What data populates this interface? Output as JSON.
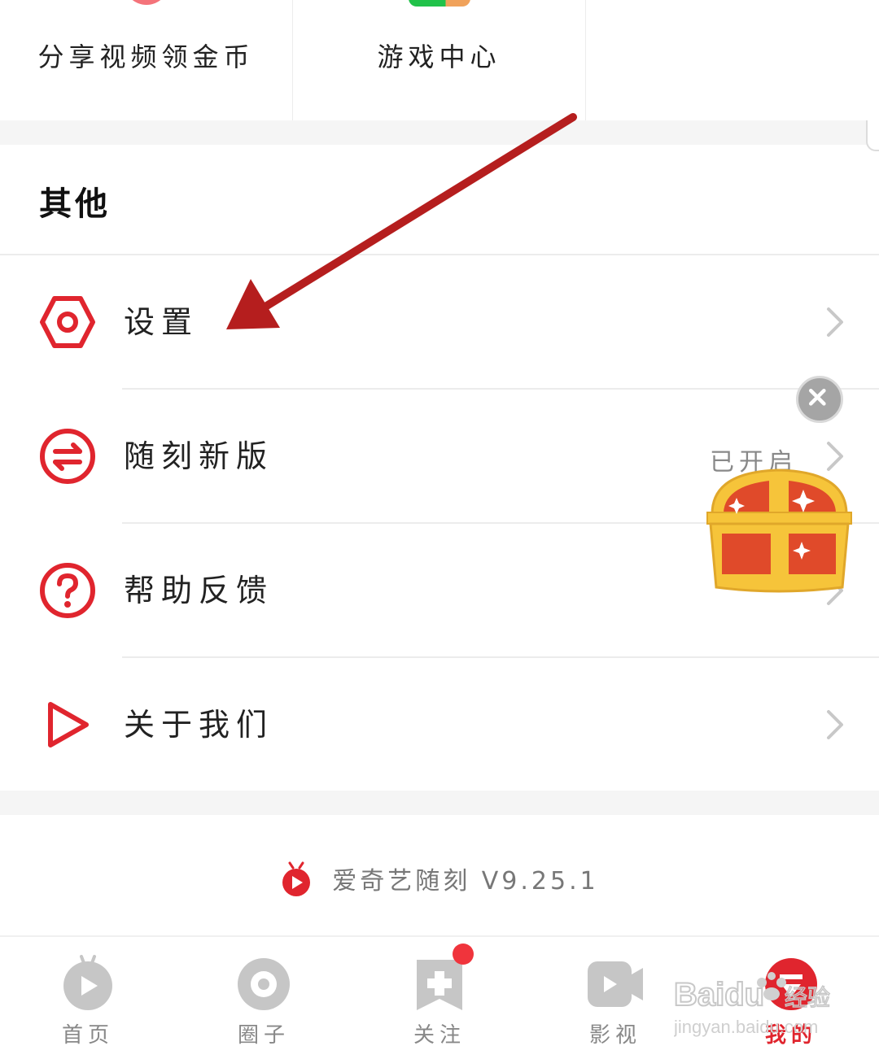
{
  "top_grid": {
    "items": [
      {
        "label": "分享视频领金币",
        "icon": "coin-share-icon"
      },
      {
        "label": "游戏中心",
        "icon": "game-center-icon"
      },
      {
        "label": "",
        "icon": ""
      }
    ]
  },
  "section": {
    "title": "其他",
    "items": [
      {
        "label": "设置",
        "icon": "settings-hex-icon",
        "status": ""
      },
      {
        "label": "随刻新版",
        "icon": "switch-arrows-icon",
        "status": "已开启"
      },
      {
        "label": "帮助反馈",
        "icon": "help-question-icon",
        "status": ""
      },
      {
        "label": "关于我们",
        "icon": "play-triangle-icon",
        "status": ""
      }
    ]
  },
  "version": {
    "text": "爱奇艺随刻 V9.25.1",
    "logo": "iqiyi-suike-logo"
  },
  "tabbar": {
    "tabs": [
      {
        "label": "首页",
        "icon": "home-tv-icon",
        "active": false
      },
      {
        "label": "圈子",
        "icon": "circle-icon",
        "active": false
      },
      {
        "label": "关注",
        "icon": "follow-bookmark-icon",
        "active": false,
        "badge": true
      },
      {
        "label": "影视",
        "icon": "video-camera-icon",
        "active": false
      },
      {
        "label": "我的",
        "icon": "profile-icon",
        "active": true
      }
    ]
  },
  "watermark": {
    "brand": "Baidu",
    "sub": "经验",
    "url": "jingyan.baidu.com"
  },
  "colors": {
    "accent": "#e0252e",
    "arrow": "#b51e1e",
    "divider": "#ececec",
    "band": "#f5f5f5"
  }
}
